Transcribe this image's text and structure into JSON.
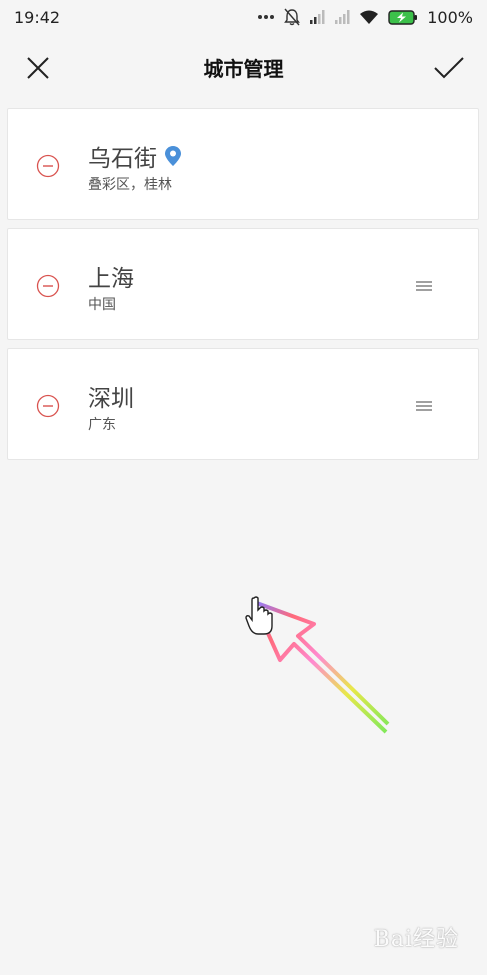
{
  "status_bar": {
    "time": "19:42",
    "battery": "100%",
    "icons": [
      "more-dots-icon",
      "mute-bell-icon",
      "signal-icon",
      "signal-icon",
      "wifi-icon",
      "battery-charging-icon"
    ]
  },
  "header": {
    "title": "城市管理",
    "close_icon": "close-icon",
    "confirm_icon": "check-icon"
  },
  "cities": [
    {
      "name": "乌石街",
      "region": "叠彩区，桂林",
      "current_location": true,
      "draggable": false
    },
    {
      "name": "上海",
      "region": "中国",
      "current_location": false,
      "draggable": true
    },
    {
      "name": "深圳",
      "region": "广东",
      "current_location": false,
      "draggable": true
    }
  ],
  "colors": {
    "remove": "#d9534f",
    "location_pin": "#4a90d9",
    "background": "#f5f5f5"
  },
  "watermark": "Bai经验"
}
